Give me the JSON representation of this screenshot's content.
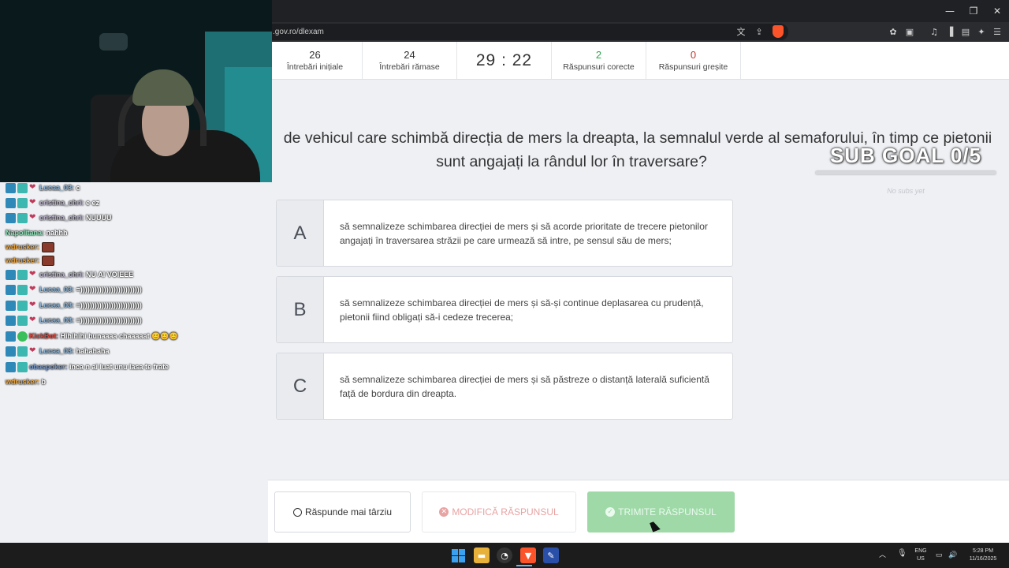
{
  "browser": {
    "url": ".gov.ro/dlexam",
    "window_controls": [
      "—",
      "❐",
      "✕"
    ]
  },
  "stats": {
    "initial": {
      "value": "26",
      "label": "Întrebări inițiale"
    },
    "remaining": {
      "value": "24",
      "label": "Întrebări rămase"
    },
    "timer": "29 : 22",
    "correct": {
      "value": "2",
      "label": "Răspunsuri corecte"
    },
    "wrong": {
      "value": "0",
      "label": "Răspunsuri greșite"
    }
  },
  "question": {
    "text_line1": "de vehicul care schimbă direcția de mers la dreapta, la semnalul verde al semaforului, în timp ce pietonii",
    "text_line2": "sunt angajați la rândul lor în traversare?"
  },
  "answers": [
    {
      "letter": "A",
      "text": "să semnalizeze schimbarea direcției de mers și să acorde prioritate de trecere pietonilor angajați în traversarea străzii pe care urmează să intre, pe sensul său de mers;"
    },
    {
      "letter": "B",
      "text": "să semnalizeze schimbarea direcției de mers și să-și continue deplasarea cu prudență, pietonii fiind obligați să-i cedeze trecerea;"
    },
    {
      "letter": "C",
      "text": "să semnalizeze schimbarea direcției de mers și să păstreze o distanță laterală suficientă față de bordura din dreapta."
    }
  ],
  "buttons": {
    "later": "Răspunde mai târziu",
    "modify": "MODIFICĂ RĂSPUNSUL",
    "submit": "TRIMITE RĂSPUNSUL"
  },
  "overlay": {
    "sub_goal": "SUB GOAL 0/5",
    "no_subs": "No subs yet"
  },
  "chat": [
    {
      "user": "Lucaa_03:",
      "msg": "c"
    },
    {
      "user": "cristina_chri:",
      "msg": "e ez"
    },
    {
      "user": "cristina_chri:",
      "msg": "NUUUU"
    },
    {
      "user": "Napolitana:",
      "msg": "nahhh"
    },
    {
      "user": "wdrusker:",
      "msg": ""
    },
    {
      "user": "wdrusker:",
      "msg": ""
    },
    {
      "user": "cristina_chri:",
      "msg": "NU AI VOIEEE"
    },
    {
      "user": "Lucaa_03:",
      "msg": "=))))))))))))))))))))))))))"
    },
    {
      "user": "Lucaa_03:",
      "msg": "=))))))))))))))))))))))))))"
    },
    {
      "user": "Lucaa_03:",
      "msg": "=))))))))))))))))))))))))))"
    },
    {
      "user": "KickBot:",
      "msg": "Hihihihi bunaaaa chaaaaat 😊😊😊"
    },
    {
      "user": "Lucaa_03:",
      "msg": "hahahaha"
    },
    {
      "user": "obaspoker:",
      "msg": "inca n ai luat unu lasa te frate"
    },
    {
      "user": "wdrusker:",
      "msg": "b"
    }
  ],
  "taskbar": {
    "lang": "ENG",
    "region": "US",
    "time": "5:28 PM",
    "date": "11/16/2025"
  },
  "colors": {
    "correct": "#2ea44f",
    "wrong": "#c0392b",
    "submit_bg": "#9ed9a7",
    "modify_text": "#e8a3a3"
  }
}
